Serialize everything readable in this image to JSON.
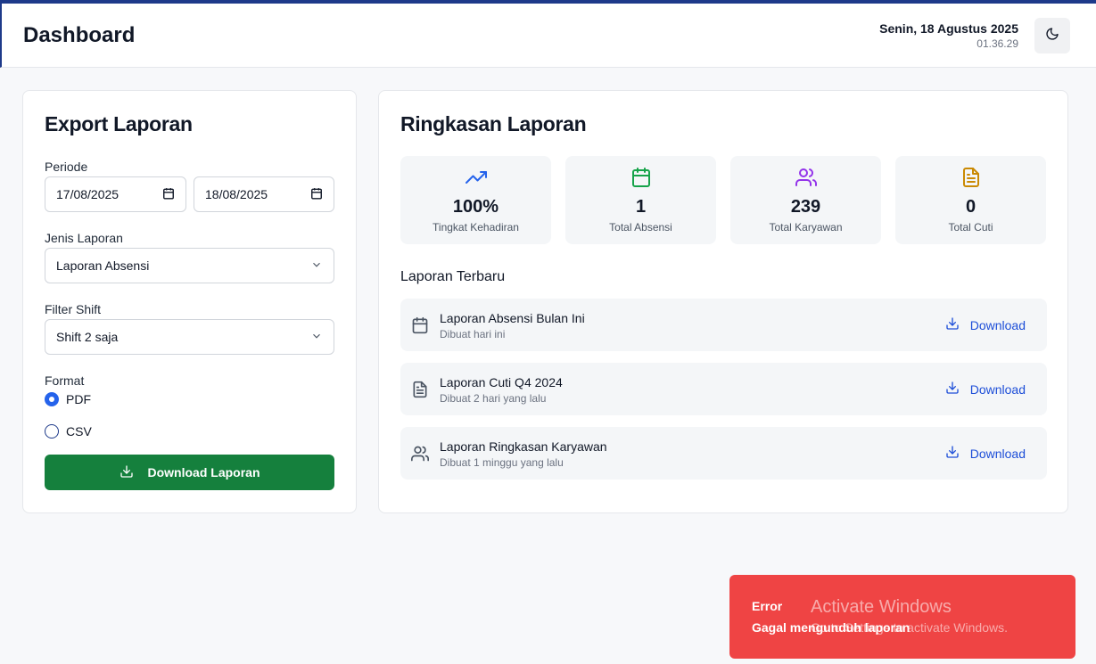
{
  "header": {
    "title": "Dashboard",
    "date": "Senin, 18 Agustus 2025",
    "time": "01.36.29",
    "theme_icon": "moon-icon"
  },
  "export": {
    "title": "Export Laporan",
    "period_label": "Periode",
    "date_from": "17/08/2025",
    "date_to": "18/08/2025",
    "type_label": "Jenis Laporan",
    "type_value": "Laporan Absensi",
    "shift_label": "Filter Shift",
    "shift_value": "Shift 2 saja",
    "format_label": "Format",
    "formats": [
      {
        "label": "PDF",
        "selected": true
      },
      {
        "label": "CSV",
        "selected": false
      }
    ],
    "download_label": "Download Laporan",
    "download_color": "#15803d"
  },
  "summary": {
    "title": "Ringkasan Laporan",
    "stats": [
      {
        "value": "100%",
        "label": "Tingkat Kehadiran",
        "icon": "trending-up-icon",
        "color": "#2563eb"
      },
      {
        "value": "1",
        "label": "Total Absensi",
        "icon": "calendar-icon",
        "color": "#16a34a"
      },
      {
        "value": "239",
        "label": "Total Karyawan",
        "icon": "users-icon",
        "color": "#9333ea"
      },
      {
        "value": "0",
        "label": "Total Cuti",
        "icon": "file-text-icon",
        "color": "#ca8a04"
      }
    ],
    "recent_title": "Laporan Terbaru",
    "reports": [
      {
        "name": "Laporan Absensi Bulan Ini",
        "meta": "Dibuat hari ini",
        "icon": "calendar-icon",
        "action": "Download"
      },
      {
        "name": "Laporan Cuti Q4 2024",
        "meta": "Dibuat 2 hari yang lalu",
        "icon": "file-text-icon",
        "action": "Download"
      },
      {
        "name": "Laporan Ringkasan Karyawan",
        "meta": "Dibuat 1 minggu yang lalu",
        "icon": "users-icon",
        "action": "Download"
      }
    ]
  },
  "toast": {
    "title": "Error",
    "message": "Gagal mengunduh laporan",
    "color": "#ef4444"
  },
  "watermark": {
    "line1": "Activate Windows",
    "line2": "Go to Settings to activate Windows."
  }
}
